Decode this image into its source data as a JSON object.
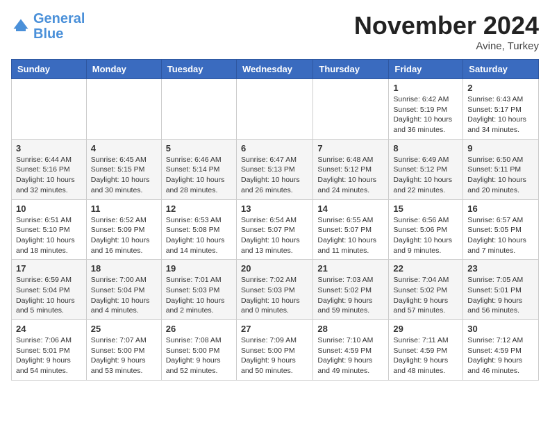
{
  "header": {
    "logo_line1": "General",
    "logo_line2": "Blue",
    "month_title": "November 2024",
    "location": "Avine, Turkey"
  },
  "weekdays": [
    "Sunday",
    "Monday",
    "Tuesday",
    "Wednesday",
    "Thursday",
    "Friday",
    "Saturday"
  ],
  "weeks": [
    [
      {
        "day": "",
        "text": ""
      },
      {
        "day": "",
        "text": ""
      },
      {
        "day": "",
        "text": ""
      },
      {
        "day": "",
        "text": ""
      },
      {
        "day": "",
        "text": ""
      },
      {
        "day": "1",
        "text": "Sunrise: 6:42 AM\nSunset: 5:19 PM\nDaylight: 10 hours and 36 minutes."
      },
      {
        "day": "2",
        "text": "Sunrise: 6:43 AM\nSunset: 5:17 PM\nDaylight: 10 hours and 34 minutes."
      }
    ],
    [
      {
        "day": "3",
        "text": "Sunrise: 6:44 AM\nSunset: 5:16 PM\nDaylight: 10 hours and 32 minutes."
      },
      {
        "day": "4",
        "text": "Sunrise: 6:45 AM\nSunset: 5:15 PM\nDaylight: 10 hours and 30 minutes."
      },
      {
        "day": "5",
        "text": "Sunrise: 6:46 AM\nSunset: 5:14 PM\nDaylight: 10 hours and 28 minutes."
      },
      {
        "day": "6",
        "text": "Sunrise: 6:47 AM\nSunset: 5:13 PM\nDaylight: 10 hours and 26 minutes."
      },
      {
        "day": "7",
        "text": "Sunrise: 6:48 AM\nSunset: 5:12 PM\nDaylight: 10 hours and 24 minutes."
      },
      {
        "day": "8",
        "text": "Sunrise: 6:49 AM\nSunset: 5:12 PM\nDaylight: 10 hours and 22 minutes."
      },
      {
        "day": "9",
        "text": "Sunrise: 6:50 AM\nSunset: 5:11 PM\nDaylight: 10 hours and 20 minutes."
      }
    ],
    [
      {
        "day": "10",
        "text": "Sunrise: 6:51 AM\nSunset: 5:10 PM\nDaylight: 10 hours and 18 minutes."
      },
      {
        "day": "11",
        "text": "Sunrise: 6:52 AM\nSunset: 5:09 PM\nDaylight: 10 hours and 16 minutes."
      },
      {
        "day": "12",
        "text": "Sunrise: 6:53 AM\nSunset: 5:08 PM\nDaylight: 10 hours and 14 minutes."
      },
      {
        "day": "13",
        "text": "Sunrise: 6:54 AM\nSunset: 5:07 PM\nDaylight: 10 hours and 13 minutes."
      },
      {
        "day": "14",
        "text": "Sunrise: 6:55 AM\nSunset: 5:07 PM\nDaylight: 10 hours and 11 minutes."
      },
      {
        "day": "15",
        "text": "Sunrise: 6:56 AM\nSunset: 5:06 PM\nDaylight: 10 hours and 9 minutes."
      },
      {
        "day": "16",
        "text": "Sunrise: 6:57 AM\nSunset: 5:05 PM\nDaylight: 10 hours and 7 minutes."
      }
    ],
    [
      {
        "day": "17",
        "text": "Sunrise: 6:59 AM\nSunset: 5:04 PM\nDaylight: 10 hours and 5 minutes."
      },
      {
        "day": "18",
        "text": "Sunrise: 7:00 AM\nSunset: 5:04 PM\nDaylight: 10 hours and 4 minutes."
      },
      {
        "day": "19",
        "text": "Sunrise: 7:01 AM\nSunset: 5:03 PM\nDaylight: 10 hours and 2 minutes."
      },
      {
        "day": "20",
        "text": "Sunrise: 7:02 AM\nSunset: 5:03 PM\nDaylight: 10 hours and 0 minutes."
      },
      {
        "day": "21",
        "text": "Sunrise: 7:03 AM\nSunset: 5:02 PM\nDaylight: 9 hours and 59 minutes."
      },
      {
        "day": "22",
        "text": "Sunrise: 7:04 AM\nSunset: 5:02 PM\nDaylight: 9 hours and 57 minutes."
      },
      {
        "day": "23",
        "text": "Sunrise: 7:05 AM\nSunset: 5:01 PM\nDaylight: 9 hours and 56 minutes."
      }
    ],
    [
      {
        "day": "24",
        "text": "Sunrise: 7:06 AM\nSunset: 5:01 PM\nDaylight: 9 hours and 54 minutes."
      },
      {
        "day": "25",
        "text": "Sunrise: 7:07 AM\nSunset: 5:00 PM\nDaylight: 9 hours and 53 minutes."
      },
      {
        "day": "26",
        "text": "Sunrise: 7:08 AM\nSunset: 5:00 PM\nDaylight: 9 hours and 52 minutes."
      },
      {
        "day": "27",
        "text": "Sunrise: 7:09 AM\nSunset: 5:00 PM\nDaylight: 9 hours and 50 minutes."
      },
      {
        "day": "28",
        "text": "Sunrise: 7:10 AM\nSunset: 4:59 PM\nDaylight: 9 hours and 49 minutes."
      },
      {
        "day": "29",
        "text": "Sunrise: 7:11 AM\nSunset: 4:59 PM\nDaylight: 9 hours and 48 minutes."
      },
      {
        "day": "30",
        "text": "Sunrise: 7:12 AM\nSunset: 4:59 PM\nDaylight: 9 hours and 46 minutes."
      }
    ]
  ]
}
